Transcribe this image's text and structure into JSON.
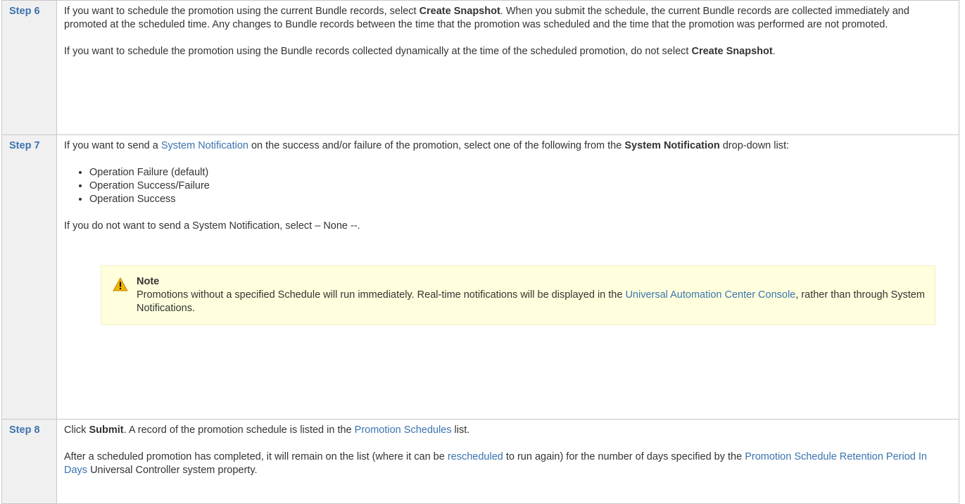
{
  "steps": [
    {
      "label": "Step 6",
      "p1_pre": "If you want to schedule the promotion using the current Bundle records, select ",
      "p1_bold": "Create Snapshot",
      "p1_post": ". When you submit the schedule, the current Bundle records are collected immediately and promoted at the scheduled time. Any changes to Bundle records between the time that the promotion was scheduled and the time that the promotion was performed are not promoted.",
      "p2_pre": "If you want to schedule the promotion using the Bundle records collected dynamically at the time of the scheduled promotion, do not select ",
      "p2_bold": "Create Snapshot",
      "p2_post": "."
    },
    {
      "label": "Step 7",
      "p1_pre": "If you want to send a ",
      "p1_link": "System Notification",
      "p1_mid": " on the success and/or failure of the promotion, select one of the following from the ",
      "p1_bold": "System Notification",
      "p1_post": " drop-down list:",
      "options": [
        "Operation Failure (default)",
        "Operation Success/Failure",
        "Operation Success"
      ],
      "p2": "If you do not want to send a System Notification, select – None --.",
      "note": {
        "icon": "warning-icon",
        "title": "Note",
        "text_pre": "Promotions without a specified Schedule will run immediately. Real-time notifications will be displayed in the ",
        "link": "Universal Automation Center Console",
        "text_post": ", rather than through System Notifications."
      }
    },
    {
      "label": "Step 8",
      "p1_pre": "Click ",
      "p1_bold": "Submit",
      "p1_mid": ". A record of the promotion schedule is listed in the ",
      "p1_link": "Promotion Schedules",
      "p1_post": " list.",
      "p2_pre": "After a scheduled promotion has completed, it will remain on the list (where it can be ",
      "p2_link1": "rescheduled",
      "p2_mid": " to run again) for the number of days specified by the ",
      "p2_link2": "Promotion Schedule Retention Period In Days",
      "p2_post": " Universal Controller system property."
    }
  ],
  "colors": {
    "link": "#3b73af",
    "label_bg": "#f0f0f0",
    "note_bg": "#ffffdd",
    "warning": "#f0b400"
  }
}
